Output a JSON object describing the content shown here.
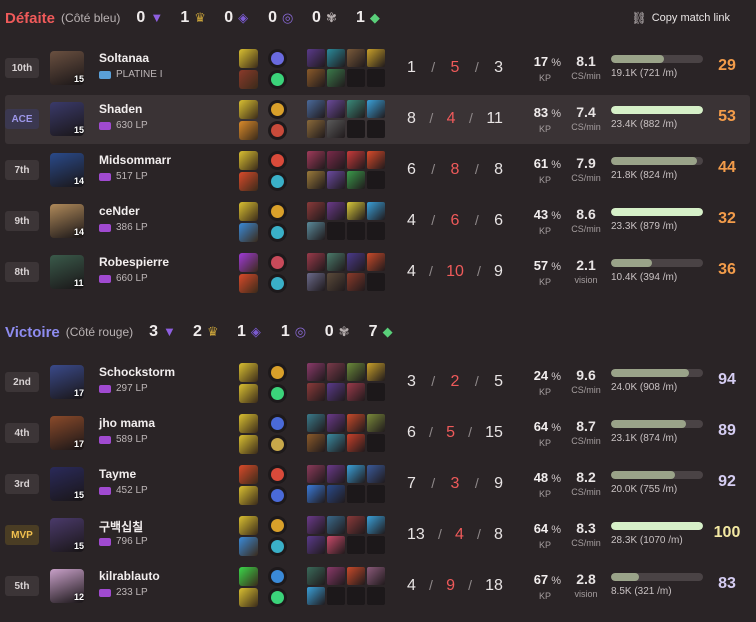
{
  "copy_link": "Copy match link",
  "teams": [
    {
      "name": "Défaite",
      "side": "(Côté bleu)",
      "color": "#ef5a5a",
      "objectives": [
        {
          "icon": "tower-icon",
          "value": "0"
        },
        {
          "icon": "dragon-icon",
          "value": "1"
        },
        {
          "icon": "baron-icon",
          "value": "0"
        },
        {
          "icon": "herald-icon",
          "value": "0"
        },
        {
          "icon": "grub-icon",
          "value": "0"
        },
        {
          "icon": "inhibitor-icon",
          "value": "1"
        }
      ],
      "players": [
        {
          "rank": "10th",
          "badge": "",
          "level": "15",
          "name": "Soltanaa",
          "tier": "PLATINE I",
          "k": "1",
          "d": "5",
          "a": "3",
          "kp": "17",
          "cs": "8.1",
          "cs_label": "CS/min",
          "dmg_pct": 0.58,
          "dmg": "19.1K (721 /m)",
          "score": "29",
          "avatar": "#6a5040",
          "spells": [
            "#d9c031",
            "#8a3a2a"
          ],
          "runes": [
            "#6a6adf",
            "#3bd37a"
          ],
          "items": [
            "#5a3a8a",
            "#2a8a9a",
            "#7a5a3a",
            "#c8a02a",
            "#8a5a2a",
            "#3a7a4a",
            "",
            ""
          ]
        },
        {
          "rank": "ACE",
          "badge": "ace",
          "level": "15",
          "name": "Shaden",
          "tier": "630 LP",
          "k": "8",
          "d": "4",
          "a": "11",
          "kp": "83",
          "cs": "7.4",
          "cs_label": "CS/min",
          "dmg_pct": 1.0,
          "dmg": "23.4K (882 /m)",
          "score": "53",
          "avatar": "#3a3a6a",
          "spells": [
            "#d9c031",
            "#d98a2a"
          ],
          "runes": [
            "#d9a02a",
            "#c84a3a"
          ],
          "items": [
            "#4a6a9a",
            "#6a4a9a",
            "#3a8a7a",
            "#3aa0d8",
            "#8a6a3a",
            "#5a5a5a",
            "",
            ""
          ]
        },
        {
          "rank": "7th",
          "badge": "",
          "level": "14",
          "name": "Midsommarr",
          "tier": "517 LP",
          "k": "6",
          "d": "8",
          "a": "8",
          "kp": "61",
          "cs": "7.9",
          "cs_label": "CS/min",
          "dmg_pct": 0.93,
          "dmg": "21.8K (824 /m)",
          "score": "44",
          "avatar": "#2a4a8a",
          "spells": [
            "#d9c031",
            "#d94a2a"
          ],
          "runes": [
            "#d94a3a",
            "#3ab0c8"
          ],
          "items": [
            "#a03a5a",
            "#7a2a4a",
            "#c83a3a",
            "#d84a2a",
            "#9a7a3a",
            "#6a4aa0",
            "#3a9a4a",
            ""
          ]
        },
        {
          "rank": "9th",
          "badge": "",
          "level": "14",
          "name": "ceNder",
          "tier": "386 LP",
          "k": "4",
          "d": "6",
          "a": "6",
          "kp": "43",
          "cs": "8.6",
          "cs_label": "CS/min",
          "dmg_pct": 1.0,
          "dmg": "23.3K (879 /m)",
          "score": "32",
          "avatar": "#b08a5a",
          "spells": [
            "#d9c031",
            "#3a8ad8"
          ],
          "runes": [
            "#d9a02a",
            "#3ab0c8"
          ],
          "items": [
            "#8a3a3a",
            "#6a3a8a",
            "#d8c83a",
            "#3aa0d8",
            "#5a8a9a",
            "",
            "",
            ""
          ]
        },
        {
          "rank": "8th",
          "badge": "",
          "level": "11",
          "name": "Robespierre",
          "tier": "660 LP",
          "k": "4",
          "d": "10",
          "a": "9",
          "kp": "57",
          "cs": "2.1",
          "cs_label": "vision",
          "dmg_pct": 0.45,
          "dmg": "10.4K (394 /m)",
          "score": "36",
          "avatar": "#3a5a4a",
          "spells": [
            "#a03ad8",
            "#d94a2a"
          ],
          "runes": [
            "#c84a5a",
            "#3ab0c8"
          ],
          "items": [
            "#9a3a4a",
            "#4a7a6a",
            "#4a3a8a",
            "#c84a2a",
            "#6a6a8a",
            "#5a4a3a",
            "#8a3a2a",
            ""
          ]
        }
      ]
    },
    {
      "name": "Victoire",
      "side": "(Côté rouge)",
      "color": "#8e8cf0",
      "objectives": [
        {
          "icon": "tower-icon",
          "value": "3"
        },
        {
          "icon": "dragon-icon",
          "value": "2"
        },
        {
          "icon": "baron-icon",
          "value": "1"
        },
        {
          "icon": "herald-icon",
          "value": "1"
        },
        {
          "icon": "grub-icon",
          "value": "0"
        },
        {
          "icon": "inhibitor-icon",
          "value": "7"
        }
      ],
      "players": [
        {
          "rank": "2nd",
          "badge": "",
          "level": "17",
          "name": "Schockstorm",
          "tier": "297 LP",
          "k": "3",
          "d": "2",
          "a": "5",
          "kp": "24",
          "cs": "9.6",
          "cs_label": "CS/min",
          "dmg_pct": 0.85,
          "dmg": "24.0K (908 /m)",
          "score": "94",
          "avatar": "#3a4a8a",
          "spells": [
            "#d9c031",
            "#d9c031"
          ],
          "runes": [
            "#d9a02a",
            "#3bd37a"
          ],
          "items": [
            "#8a3a6a",
            "#7a3a4a",
            "#6a8a3a",
            "#c8a02a",
            "#8a3a3a",
            "#5a3a8a",
            "#9a3a4a",
            ""
          ]
        },
        {
          "rank": "4th",
          "badge": "",
          "level": "17",
          "name": "jho mama",
          "tier": "589 LP",
          "k": "6",
          "d": "5",
          "a": "15",
          "kp": "64",
          "cs": "8.7",
          "cs_label": "CS/min",
          "dmg_pct": 0.82,
          "dmg": "23.1K (874 /m)",
          "score": "89",
          "avatar": "#8a4a2a",
          "spells": [
            "#d9c031",
            "#d9c031"
          ],
          "runes": [
            "#4a6ad8",
            "#c8a84a"
          ],
          "items": [
            "#3a7a8a",
            "#6a3a8a",
            "#c84a2a",
            "#7a8a3a",
            "#8a5a2a",
            "#3a8aa0",
            "#c8402a",
            ""
          ]
        },
        {
          "rank": "3rd",
          "badge": "",
          "level": "15",
          "name": "Tayme",
          "tier": "452 LP",
          "k": "7",
          "d": "3",
          "a": "9",
          "kp": "48",
          "cs": "8.2",
          "cs_label": "CS/min",
          "dmg_pct": 0.7,
          "dmg": "20.0K (755 /m)",
          "score": "92",
          "avatar": "#2a2a5a",
          "spells": [
            "#d94a2a",
            "#d9c031"
          ],
          "runes": [
            "#d94a3a",
            "#4a6ad8"
          ],
          "items": [
            "#8a3a5a",
            "#6a3a8a",
            "#3aa0d8",
            "#3a5a9a",
            "#3a7ad8",
            "#2a4a8a",
            "",
            ""
          ]
        },
        {
          "rank": "MVP",
          "badge": "mvp",
          "level": "15",
          "name": "구백십칠",
          "tier": "796 LP",
          "k": "13",
          "d": "4",
          "a": "8",
          "kp": "64",
          "cs": "8.3",
          "cs_label": "CS/min",
          "dmg_pct": 1.0,
          "dmg": "28.3K (1070 /m)",
          "score": "100",
          "avatar": "#4a3a6a",
          "spells": [
            "#d9c031",
            "#3a8ad8"
          ],
          "runes": [
            "#d9a02a",
            "#3ab0c8"
          ],
          "items": [
            "#6a3a8a",
            "#3a6a8a",
            "#8a3a3a",
            "#3aa0d8",
            "#5a3a8a",
            "#c84a6a",
            "",
            ""
          ]
        },
        {
          "rank": "5th",
          "badge": "",
          "level": "12",
          "name": "kilrablauto",
          "tier": "233 LP",
          "k": "4",
          "d": "9",
          "a": "18",
          "kp": "67",
          "cs": "2.8",
          "cs_label": "vision",
          "dmg_pct": 0.3,
          "dmg": "8.5K (321 /m)",
          "score": "83",
          "avatar": "#c8a0c8",
          "spells": [
            "#3ad84a",
            "#d9c031"
          ],
          "runes": [
            "#3a8ad8",
            "#3bd37a"
          ],
          "items": [
            "#3a6a5a",
            "#8a3a6a",
            "#c84a2a",
            "#8a5a7a",
            "#3aa0d8",
            "",
            "",
            ""
          ]
        }
      ]
    }
  ]
}
